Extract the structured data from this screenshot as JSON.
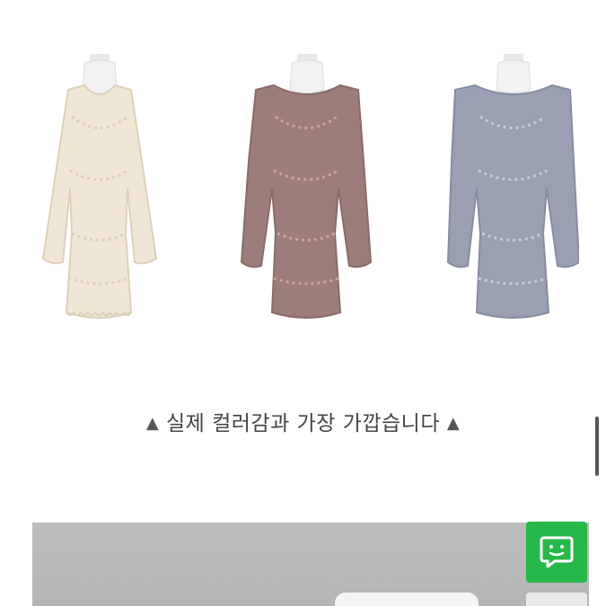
{
  "products": {
    "items": [
      {
        "name": "ivory-lace-dress",
        "color": "#efe6d6",
        "lace": "#ddd0b8"
      },
      {
        "name": "mauve-lace-dress",
        "color": "#9d7d7a",
        "lace": "#caa49e"
      },
      {
        "name": "lavender-grey-lace-dress",
        "color": "#9a9fb3",
        "lace": "#c6cbdc"
      }
    ]
  },
  "caption": {
    "left_marker": "▲",
    "text": "실제 컬러감과 가장 가깝습니다",
    "right_marker": "▲"
  },
  "chat": {
    "icon": "chat-bubble-icon",
    "color": "#27b84a"
  }
}
